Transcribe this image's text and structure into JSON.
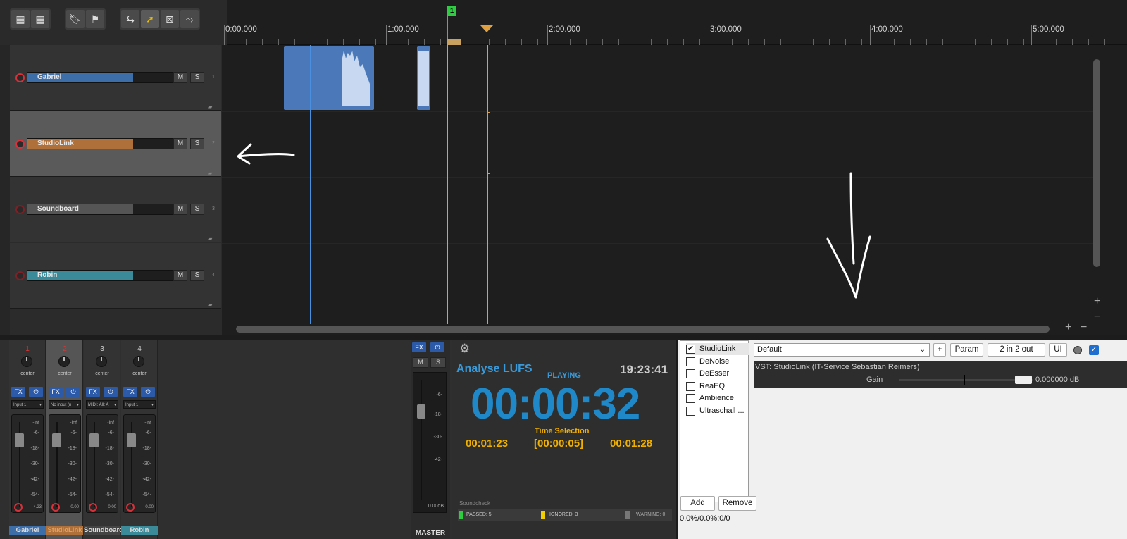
{
  "toolbar": {
    "icons": [
      "grid-icon",
      "grid-small-icon",
      "marker-icon",
      "region-marker-icon",
      "ripple-icon",
      "cursor-select-icon",
      "trim-icon",
      "envelope-icon"
    ]
  },
  "ruler": {
    "labels": [
      "0:00.000",
      "1:00.000",
      "2:00.000",
      "3:00.000",
      "4:00.000",
      "5:00.000"
    ],
    "marker_label": "1"
  },
  "tracks": [
    {
      "name": "Gabriel",
      "number": "1",
      "color": "#3e6ea8",
      "mute": "M",
      "solo": "S"
    },
    {
      "name": "StudioLink",
      "number": "2",
      "color": "#b0703a",
      "mute": "M",
      "solo": "S"
    },
    {
      "name": "Soundboard",
      "number": "3",
      "color": "#555555",
      "mute": "M",
      "solo": "S"
    },
    {
      "name": "Robin",
      "number": "4",
      "color": "#3a8a9a",
      "mute": "M",
      "solo": "S"
    }
  ],
  "mixer": {
    "strips": [
      {
        "number": "1",
        "pan": "center",
        "fx": "FX",
        "input": "Input 1",
        "db_ticks": [
          "-inf",
          "-6-",
          "-18-",
          "-30-",
          "-42-",
          "-54-"
        ],
        "level": "4.23",
        "label": "Gabriel",
        "color": "#3e6ea8",
        "num_color": "#d33"
      },
      {
        "number": "2",
        "pan": "center",
        "fx": "FX",
        "input": "No input (n",
        "db_ticks": [
          "-inf",
          "-6-",
          "-18-",
          "-30-",
          "-42-",
          "-54-"
        ],
        "level": "0.00",
        "label": "StudioLink",
        "color": "#b0703a",
        "num_color": "#d33"
      },
      {
        "number": "3",
        "pan": "center",
        "fx": "FX",
        "input": "MIDI: All: A",
        "db_ticks": [
          "-inf",
          "-6-",
          "-18-",
          "-30-",
          "-42-",
          "-54-"
        ],
        "level": "0.00",
        "label": "Soundboard",
        "color": "#444444",
        "num_color": "#ccc"
      },
      {
        "number": "4",
        "pan": "center",
        "fx": "FX",
        "input": "Input 1",
        "db_ticks": [
          "-inf",
          "-6-",
          "-18-",
          "-30-",
          "-42-",
          "-54-"
        ],
        "level": "0.00",
        "label": "Robin",
        "color": "#3a8a9a",
        "num_color": "#ccc"
      }
    ],
    "master": {
      "fx": "FX",
      "mute": "M",
      "solo": "S",
      "db_ticks": [
        "-6-",
        "-18-",
        "-30-",
        "-42-"
      ],
      "level": "0.00dB",
      "label": "MASTER"
    }
  },
  "soundcheck": {
    "link": "Analyse LUFS",
    "state": "PLAYING",
    "clock": "19:23:41",
    "time": "00:00:32",
    "selection_label": "Time Selection",
    "sel_start": "00:01:23",
    "sel_len": "[00:00:05]",
    "sel_end": "00:01:28",
    "title": "Soundcheck",
    "passed": "PASSED: 5",
    "ignored": "IGNORED: 3",
    "warning": "WARNING: 0"
  },
  "fx": {
    "items": [
      {
        "name": "StudioLink",
        "checked": true
      },
      {
        "name": "DeNoise",
        "checked": false
      },
      {
        "name": "DeEsser",
        "checked": false
      },
      {
        "name": "ReaEQ",
        "checked": false
      },
      {
        "name": "Ambience",
        "checked": false
      },
      {
        "name": "Ultraschall ...",
        "checked": false
      }
    ],
    "add": "Add",
    "remove": "Remove",
    "status": "0.0%/0.0%:0/0",
    "preset": "Default",
    "plus": "+",
    "param": "Param",
    "io": "2 in 2 out",
    "ui": "UI",
    "plugin_title": "VST: StudioLink (IT-Service Sebastian Reimers)",
    "param_name": "Gain",
    "param_value": "0.000000 dB"
  }
}
